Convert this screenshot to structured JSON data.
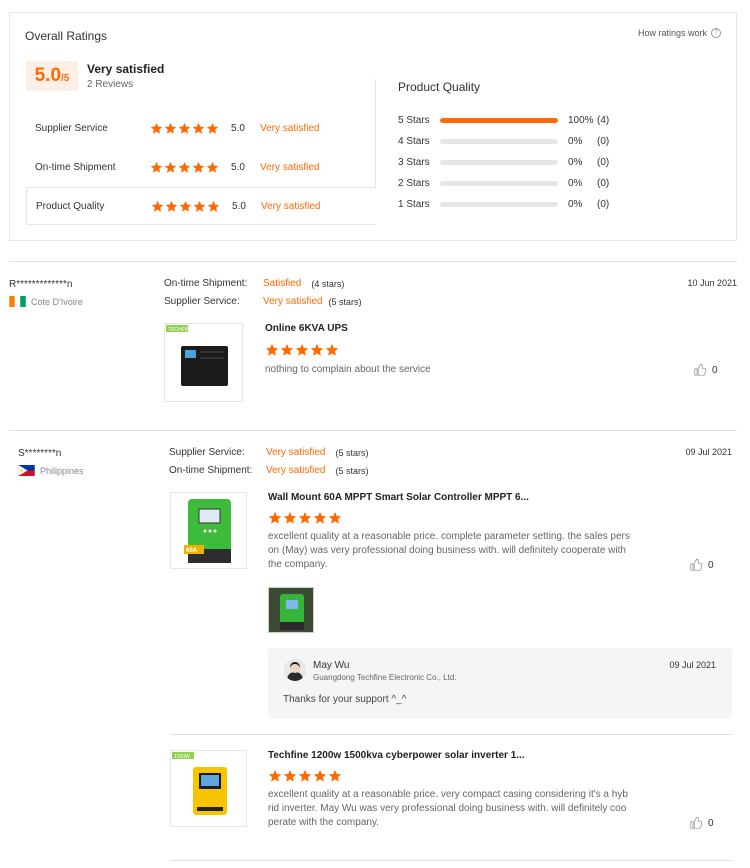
{
  "overall": {
    "title": "Overall Ratings",
    "how_link": "How ratings work",
    "score": "5.0",
    "score_max": "/5",
    "satisfaction": "Very satisfied",
    "reviews": "2 Reviews",
    "rows": [
      {
        "label": "Supplier Service",
        "score": "5.0",
        "satisfaction": "Very satisfied"
      },
      {
        "label": "On-time Shipment",
        "score": "5.0",
        "satisfaction": "Very satisfied"
      },
      {
        "label": "Product Quality",
        "score": "5.0",
        "satisfaction": "Very satisfied"
      }
    ],
    "distribution_title": "Product Quality",
    "distribution": [
      {
        "label": "5 Stars",
        "percent": "100%",
        "count": "(4)",
        "fraction": 1.0
      },
      {
        "label": "4 Stars",
        "percent": "0%",
        "count": "(0)",
        "fraction": 0
      },
      {
        "label": "3 Stars",
        "percent": "0%",
        "count": "(0)",
        "fraction": 0
      },
      {
        "label": "2 Stars",
        "percent": "0%",
        "count": "(0)",
        "fraction": 0
      },
      {
        "label": "1 Stars",
        "percent": "0%",
        "count": "(0)",
        "fraction": 0
      }
    ]
  },
  "reviews": [
    {
      "reviewer": "R*************n",
      "country": "Cote D'Ivoire",
      "date": "10 Jun 2021",
      "meta": [
        {
          "label": "On-time Shipment:",
          "value": "Satisfied",
          "stars": "(4 stars)"
        },
        {
          "label": "Supplier Service:",
          "value": "Very satisfied",
          "stars": "(5 stars)"
        }
      ],
      "items": [
        {
          "product": "Online 6KVA UPS",
          "text": "nothing to complain about the service",
          "likes": "0",
          "badge": "TECHFINE"
        }
      ]
    },
    {
      "reviewer": "S********n",
      "country": "Philippines",
      "date": "09 Jul 2021",
      "meta": [
        {
          "label": "Supplier Service:",
          "value": "Very satisfied",
          "stars": "(5 stars)"
        },
        {
          "label": "On-time Shipment:",
          "value": "Very satisfied",
          "stars": "(5 stars)"
        }
      ],
      "items": [
        {
          "product": "Wall Mount 60A MPPT Smart Solar Controller MPPT 6...",
          "text_lines": [
            "excellent quality at a reasonable price. complete parameter setting. the sales pers",
            "on (May) was very professional doing business with. will definitely cooperate with",
            "the company."
          ],
          "likes": "0",
          "thumb_label": "60A"
        },
        {
          "product": "Techfine 1200w 1500kva cyberpower solar inverter 1...",
          "text_lines": [
            "excellent quality at a reasonable price. very compact casing considering it's a hyb",
            "rid inverter. May Wu was very professional doing business with. will definitely coo",
            "perate with the company."
          ],
          "likes": "0",
          "badge": "1200W"
        }
      ],
      "reply": {
        "name": "May Wu",
        "company": "Guangdong Techfine Electronic Co., Ltd.",
        "date": "09 Jul 2021",
        "text": "Thanks for your support ^_^"
      }
    }
  ],
  "colors": {
    "accent": "#ff6a00",
    "border": "#e6e6e6"
  }
}
